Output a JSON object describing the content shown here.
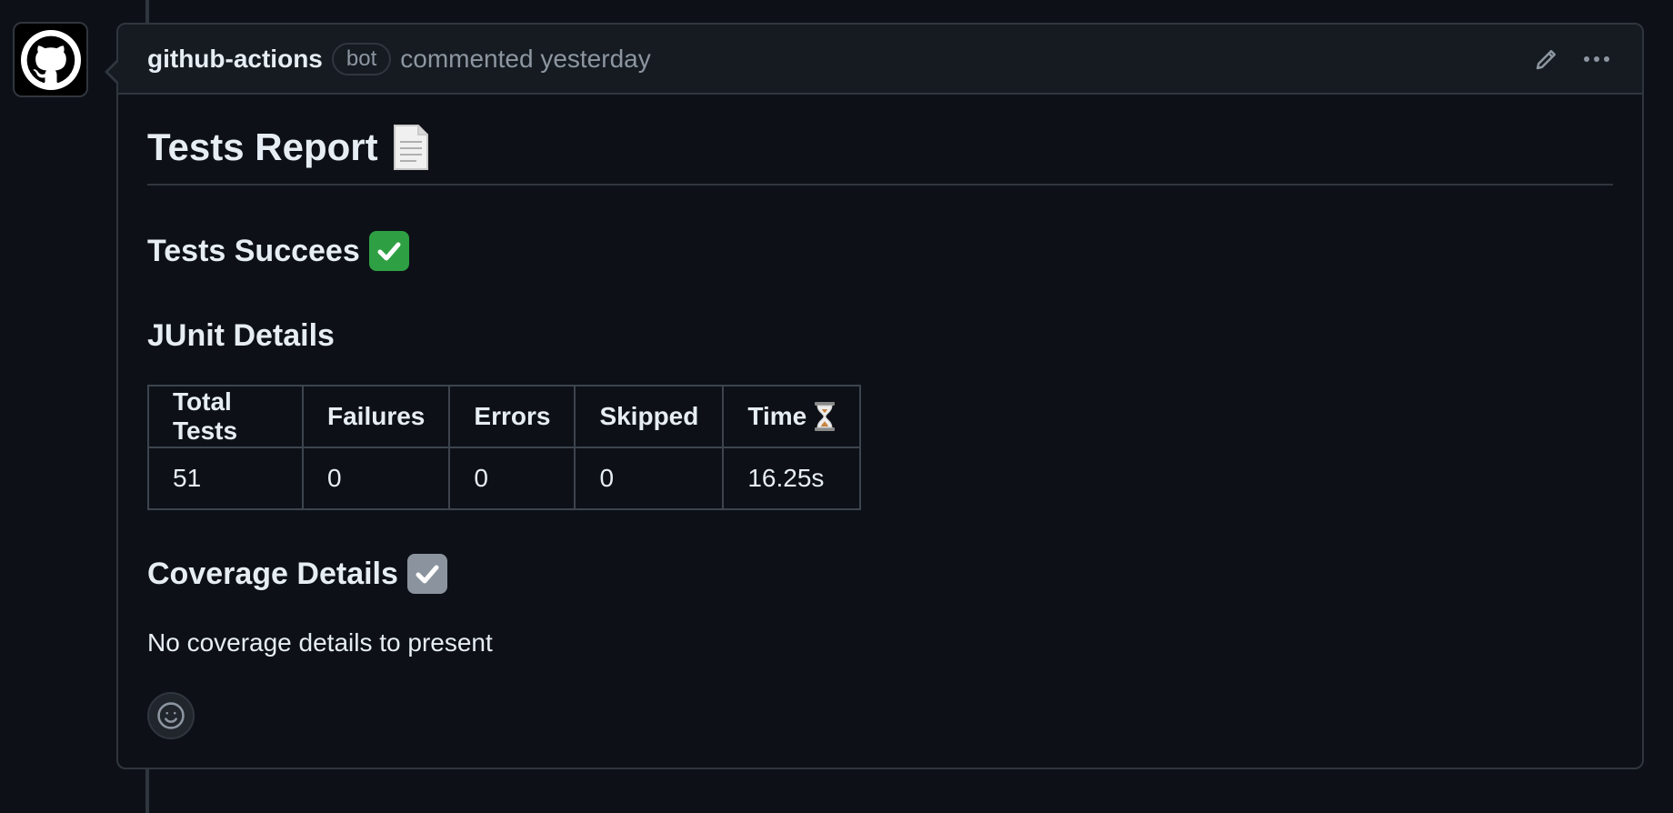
{
  "comment": {
    "author": "github-actions",
    "badge": "bot",
    "timestamp": "commented yesterday"
  },
  "report": {
    "title": "Tests Report",
    "title_icon": "document-icon",
    "status_heading": "Tests Succees",
    "status_icon": "green-check-icon",
    "junit_heading": "JUnit Details",
    "junit_table": {
      "headers": [
        "Total Tests",
        "Failures",
        "Errors",
        "Skipped",
        "Time"
      ],
      "time_icon": "hourglass-icon",
      "rows": [
        [
          "51",
          "0",
          "0",
          "0",
          "16.25s"
        ]
      ]
    },
    "coverage_heading": "Coverage Details",
    "coverage_icon": "gray-check-icon",
    "coverage_text": "No coverage details to present"
  },
  "colors": {
    "background": "#0d1117",
    "header_bg": "#161b22",
    "border": "#30363d",
    "text": "#e6edf3",
    "muted": "#8d96a0",
    "success": "#2ea043"
  }
}
